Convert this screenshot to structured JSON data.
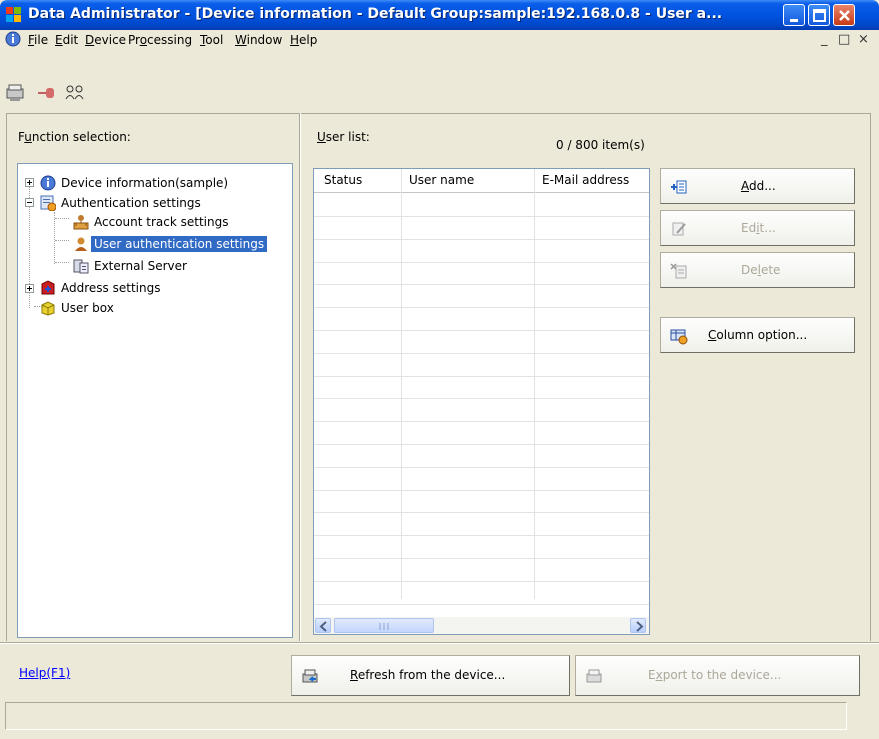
{
  "window": {
    "title": "Data Administrator - [Device information - Default Group:sample:192.168.0.8 - User a...",
    "controls": [
      "minimize",
      "maximize",
      "close"
    ]
  },
  "menubar": {
    "items": [
      {
        "label": "File",
        "accesskey_index": 0
      },
      {
        "label": "Edit",
        "accesskey_index": 0
      },
      {
        "label": "Device",
        "accesskey_index": 0
      },
      {
        "label": "Processing",
        "accesskey_index": 2
      },
      {
        "label": "Tool",
        "accesskey_index": 0
      },
      {
        "label": "Window",
        "accesskey_index": 0
      },
      {
        "label": "Help",
        "accesskey_index": 0
      }
    ],
    "mdi_controls": [
      "_",
      "□",
      "×"
    ]
  },
  "toolbar": {
    "buttons": [
      "device-icon",
      "connect-icon",
      "users-icon"
    ]
  },
  "function_panel": {
    "label": "Function selection:",
    "tree": [
      {
        "label": "Device information(sample)",
        "icon": "info-icon",
        "expandable": true,
        "expanded": false
      },
      {
        "label": "Authentication settings",
        "icon": "auth-settings-icon",
        "expandable": true,
        "expanded": true
      },
      {
        "label": "Account track settings",
        "icon": "account-track-icon"
      },
      {
        "label": "User authentication settings",
        "icon": "user-icon",
        "selected": true
      },
      {
        "label": "External Server",
        "icon": "external-server-icon"
      },
      {
        "label": "Address settings",
        "icon": "address-book-icon",
        "expandable": true,
        "expanded": false
      },
      {
        "label": "User box",
        "icon": "user-box-icon"
      }
    ]
  },
  "user_list": {
    "label": "User list:",
    "count": "0 / 800 item(s)",
    "columns": [
      "Status",
      "User name",
      "E-Mail address"
    ],
    "rows": []
  },
  "actions": {
    "add": "Add...",
    "edit": "Edit...",
    "delete": "Delete",
    "column_option": "Column option..."
  },
  "footer": {
    "help": "Help(F1)",
    "refresh": "Refresh from the device...",
    "export": "Export to the device..."
  },
  "colors": {
    "titlebar": "#0053e1",
    "selection": "#316ac5",
    "window_bg": "#ece9d8",
    "link": "#0000ff"
  }
}
